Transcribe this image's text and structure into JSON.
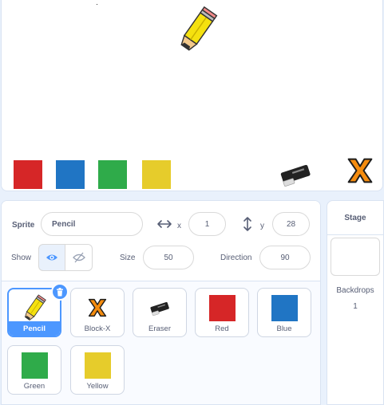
{
  "sprite_info": {
    "sprite_label": "Sprite",
    "sprite_name": "Pencil",
    "x_label": "x",
    "x_value": "1",
    "y_label": "y",
    "y_value": "28",
    "show_label": "Show",
    "size_label": "Size",
    "size_value": "50",
    "direction_label": "Direction",
    "direction_value": "90"
  },
  "stage_swatch_colors": [
    "#d62627",
    "#2075c4",
    "#2fab4a",
    "#e6cc2b"
  ],
  "sprites": [
    {
      "name": "Pencil",
      "icon": "pencil-icon",
      "selected": true
    },
    {
      "name": "Block-X",
      "icon": "block-x-icon"
    },
    {
      "name": "Eraser",
      "icon": "eraser-icon"
    },
    {
      "name": "Red",
      "color": "#d62627"
    },
    {
      "name": "Blue",
      "color": "#2075c4"
    },
    {
      "name": "Green",
      "color": "#2fab4a"
    },
    {
      "name": "Yellow",
      "color": "#e6cc2b"
    }
  ],
  "stage_panel": {
    "title": "Stage",
    "backdrops_label": "Backdrops",
    "backdrops_count": "1"
  },
  "accent_color": "#4c97ff"
}
